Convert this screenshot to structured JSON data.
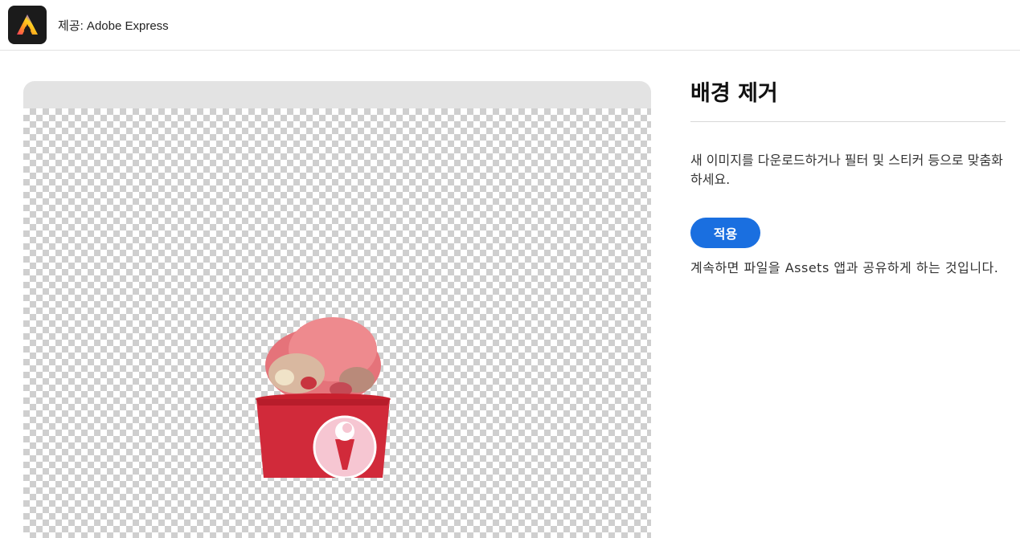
{
  "header": {
    "provider_text": "제공: Adobe Express",
    "logo_icon": "adobe-express-logo"
  },
  "preview": {
    "subject": "ice-cream-cup"
  },
  "panel": {
    "title": "배경 제거",
    "description": "새 이미지를 다운로드하거나 필터 및 스티커 등으로 맞춤화하세요.",
    "apply_label": "적용",
    "notice": "계속하면 파일을 Assets 앱과 공유하게 하는 것입니다."
  },
  "colors": {
    "accent": "#1a6fe0",
    "header_bg": "#ffffff",
    "preview_header": "#e3e3e3"
  }
}
